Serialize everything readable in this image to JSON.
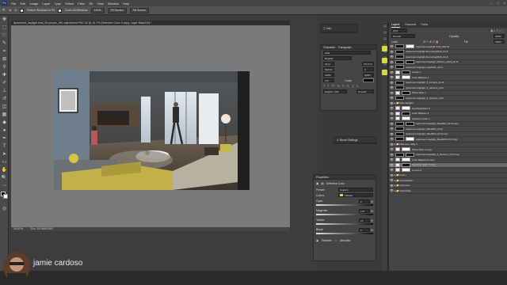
{
  "menubar": {
    "app_icon": "Ps",
    "items": [
      "File",
      "Edit",
      "Image",
      "Layer",
      "Type",
      "Select",
      "Filter",
      "3D",
      "View",
      "Window",
      "Help"
    ]
  },
  "options_bar": {
    "resize_label": "Resize Windows to Fit",
    "zoom_all_label": "Zoom All Windows",
    "btn_100": "100%",
    "fit_screen": "Fit Screen",
    "fill_screen": "Fill Screen"
  },
  "document": {
    "tab_title": "Apartment_daylight final_50 people_WD adjustment PSD 02 @ 16.7% (Selective Color 4 copy, Layer Mask/16) *",
    "zoom": "16.67%",
    "doc_size": "Doc: 54.9M/5.06G"
  },
  "info_panel": {
    "title": "Info"
  },
  "character_panel": {
    "tabs": [
      "Character",
      "Paragraph"
    ],
    "font_family": "Arial",
    "font_style": "Regular",
    "size": "24 pt",
    "leading": "30.17 pt",
    "kerning": "Metrics",
    "tracking": "0",
    "scale_v": "100%",
    "scale_h": "100%",
    "baseline": "0 pt",
    "color_label": "Color:",
    "language": "English: USA",
    "aa": "Smooth"
  },
  "brush_panel": {
    "title": "Brush Settings"
  },
  "properties_panel": {
    "title": "Properties",
    "subtitle": "Selective Color",
    "preset_label": "Preset:",
    "preset_value": "Custom",
    "colors_label": "Colors:",
    "colors_value": "Yellows",
    "channels": [
      {
        "name": "Cyan:",
        "value": "0",
        "unit": "%"
      },
      {
        "name": "Magenta:",
        "value": "+13",
        "unit": "%"
      },
      {
        "name": "Yellow:",
        "value": "+6",
        "unit": "%"
      },
      {
        "name": "Black:",
        "value": "0",
        "unit": "%"
      }
    ],
    "relative": "Relative",
    "absolute": "Absolute"
  },
  "layers_panel": {
    "tabs": [
      "Layers",
      "Channels",
      "Paths"
    ],
    "kind": "Kind",
    "blend": "Normal",
    "opacity_label": "Opacity:",
    "opacity": "100%",
    "lock_label": "Lock:",
    "fill_label": "Fill:",
    "fill": "100%",
    "rows": [
      {
        "name": "Apartment daylight final_M14.tif",
        "type": "img",
        "sel": false
      },
      {
        "name": "Apartment daylight floor+Rug0015_HI.tif",
        "type": "img",
        "sel": false
      },
      {
        "name": "Apartment daylight floor+Rug0016_HI.tif",
        "type": "img",
        "sel": false
      },
      {
        "name": "Apartment daylight_Kitchen_wash_HI.tif",
        "type": "img",
        "sel": false
      },
      {
        "name": "Apartment daylight_wash001_HI.tif",
        "type": "img",
        "sel": false
      },
      {
        "name": "Levels 1",
        "type": "adj",
        "sel": false
      },
      {
        "name": "Color Balance 1",
        "type": "adj",
        "sel": false
      },
      {
        "name": "Apartment daylight_fl_curtains_HI.tif",
        "type": "img",
        "sel": false
      },
      {
        "name": "Apartment daylight_fl_window_HI.tif",
        "type": "img",
        "sel": false
      },
      {
        "name": "Photo Filter 1",
        "type": "adj",
        "sel": false
      },
      {
        "name": "Apartment daylight_fl_window_HI.tif",
        "type": "img",
        "sel": false
      },
      {
        "name": "Ff&e daylight",
        "type": "grp",
        "sel": false
      },
      {
        "name": "Hue/Saturation 8",
        "type": "adj",
        "sel": false
      },
      {
        "name": "Color Balance 6",
        "type": "adj",
        "sel": false
      },
      {
        "name": "Selective Color 3",
        "type": "adj",
        "sel": false
      },
      {
        "name": "Apartment daylight_ff&e0001_HI.tif copy",
        "type": "img",
        "sel": false
      },
      {
        "name": "Apartment daylight_ff&e0003_HI.tif",
        "type": "img",
        "sel": false
      },
      {
        "name": "Apartment daylight_ff&e0004_HI.tif copy",
        "type": "img",
        "sel": false
      },
      {
        "name": "Apartment daylight_ff&e0005 HI.tif copy",
        "type": "img",
        "sel": false
      },
      {
        "name": "Ff&e Hue utility 1",
        "type": "grp",
        "sel": false
      },
      {
        "name": "Photo Filter 2 copy",
        "type": "adj",
        "sel": false
      },
      {
        "name": "Apartment daylight_fl_window_HI.tif copy",
        "type": "img",
        "sel": false
      },
      {
        "name": "Color Balance 6 copy",
        "type": "adj",
        "sel": false
      },
      {
        "name": "Selective Color 4 copy",
        "type": "adj",
        "sel": true
      },
      {
        "name": "Curves 2",
        "type": "adj",
        "sel": false
      },
      {
        "name": "Color+",
        "type": "grp",
        "sel": false
      },
      {
        "name": "ColourMask+",
        "type": "grp",
        "sel": false
      },
      {
        "name": "Light Gel+",
        "type": "grp",
        "sel": false
      },
      {
        "name": "Light Matte",
        "type": "grp",
        "sel": false
      }
    ]
  },
  "presenter": {
    "name": "jamie cardoso"
  },
  "colors": {
    "accent_yellow": "#d8d74a",
    "panel_bg": "#454545",
    "selected_row": "#6a6a6a"
  }
}
